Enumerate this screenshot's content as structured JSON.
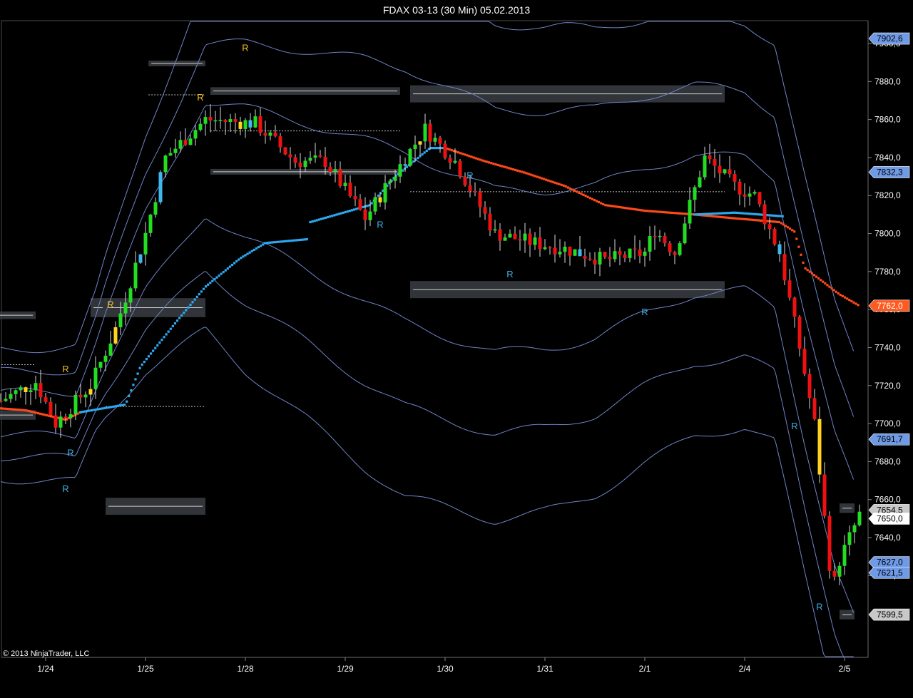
{
  "title": "FDAX 03-13 (30 Min)  05.02.2013",
  "copyright": "© 2013 NinjaTrader, LLC",
  "colors": {
    "background": "#000000",
    "up": "#22dd22",
    "down": "#ee1111",
    "highlight": "#ffd21e",
    "reversal_bar": "#3fb8f0",
    "band": "#6f84c8",
    "trail_up": "#2ea8f0",
    "trail_down": "#ff4a1a",
    "zone": "#3a3d42"
  },
  "chart_data": {
    "type": "candlestick",
    "ylim": [
      7577,
      7912
    ],
    "y_ticks": [
      "7900,0",
      "7880,0",
      "7860,0",
      "7840,0",
      "7820,0",
      "7800,0",
      "7780,0",
      "7760,0",
      "7740,0",
      "7720,0",
      "7700,0",
      "7680,0",
      "7660,0",
      "7640,0",
      "7620,0"
    ],
    "x_ticks": [
      "1/24",
      "1/25",
      "1/28",
      "1/29",
      "1/30",
      "1/31",
      "2/1",
      "2/4",
      "2/5"
    ],
    "price_badges": [
      {
        "label": "7902,6",
        "value": 7902.6,
        "style": "blue"
      },
      {
        "label": "7832,3",
        "value": 7832.3,
        "style": "blue"
      },
      {
        "label": "7762,0",
        "value": 7762.0,
        "style": "orange"
      },
      {
        "label": "7691,7",
        "value": 7691.7,
        "style": "blue"
      },
      {
        "label": "7654,5",
        "value": 7654.5,
        "style": "grey"
      },
      {
        "label": "7650,0",
        "value": 7650.0,
        "style": "white"
      },
      {
        "label": "7627,0",
        "value": 7627.0,
        "style": "blue"
      },
      {
        "label": "7621,5",
        "value": 7621.5,
        "style": "blue"
      },
      {
        "label": "7599,5",
        "value": 7599.5,
        "style": "grey"
      }
    ],
    "signals": [
      {
        "label": "R",
        "session": 0.2,
        "value": 7664,
        "color": "blue"
      },
      {
        "label": "R",
        "session": 0.25,
        "value": 7683,
        "color": "blue"
      },
      {
        "label": "R",
        "session": 0.2,
        "value": 7727,
        "color": "yellow"
      },
      {
        "label": "R",
        "session": 0.65,
        "value": 7761,
        "color": "yellow"
      },
      {
        "label": "R",
        "session": 1.55,
        "value": 7870,
        "color": "yellow"
      },
      {
        "label": "R",
        "session": 2.0,
        "value": 7896,
        "color": "yellow"
      },
      {
        "label": "R",
        "session": 3.35,
        "value": 7803,
        "color": "blue"
      },
      {
        "label": "R",
        "session": 4.25,
        "value": 7829,
        "color": "blue"
      },
      {
        "label": "R",
        "session": 4.65,
        "value": 7777,
        "color": "blue"
      },
      {
        "label": "R",
        "session": 6.0,
        "value": 7757,
        "color": "blue"
      },
      {
        "label": "R",
        "session": 7.5,
        "value": 7697,
        "color": "blue"
      },
      {
        "label": "R",
        "session": 7.75,
        "value": 7602,
        "color": "blue"
      }
    ],
    "zones": [
      {
        "x0": -0.5,
        "x1": -0.1,
        "y0": 7755,
        "y1": 7759
      },
      {
        "x0": -0.5,
        "x1": -0.1,
        "y0": 7702,
        "y1": 7707
      },
      {
        "x0": 0.45,
        "x1": 0.6,
        "y0": 7756,
        "y1": 7766
      },
      {
        "x0": 0.6,
        "x1": 1.6,
        "y0": 7756,
        "y1": 7766
      },
      {
        "x0": 0.6,
        "x1": 1.6,
        "y0": 7652,
        "y1": 7661
      },
      {
        "x0": 1.03,
        "x1": 1.6,
        "y0": 7888,
        "y1": 7891
      },
      {
        "x0": 1.65,
        "x1": 3.55,
        "y0": 7873,
        "y1": 7877
      },
      {
        "x0": 1.65,
        "x1": 3.55,
        "y0": 7831,
        "y1": 7834
      },
      {
        "x0": 3.65,
        "x1": 6.8,
        "y0": 7869,
        "y1": 7878
      },
      {
        "x0": 3.65,
        "x1": 6.8,
        "y0": 7766,
        "y1": 7775
      },
      {
        "x0": 7.95,
        "x1": 8.1,
        "y0": 7653,
        "y1": 7658
      },
      {
        "x0": 7.95,
        "x1": 8.1,
        "y0": 7597,
        "y1": 7602
      }
    ],
    "ref_lines": [
      {
        "x0": -0.5,
        "x1": -0.1,
        "value": 7731
      },
      {
        "x0": 0.6,
        "x1": 1.6,
        "value": 7709
      },
      {
        "x0": 1.03,
        "x1": 1.6,
        "value": 7873
      },
      {
        "x0": 1.65,
        "x1": 3.55,
        "value": 7854
      },
      {
        "x0": 3.65,
        "x1": 6.8,
        "value": 7822
      }
    ],
    "anchors": [
      [
        -0.45,
        7712
      ],
      [
        -0.1,
        7722
      ],
      [
        0.1,
        7700
      ],
      [
        0.45,
        7720
      ],
      [
        0.7,
        7750
      ],
      [
        1.0,
        7800
      ],
      [
        1.2,
        7840
      ],
      [
        1.6,
        7860
      ],
      [
        2.1,
        7858
      ],
      [
        2.5,
        7838
      ],
      [
        2.8,
        7838
      ],
      [
        3.2,
        7808
      ],
      [
        3.5,
        7832
      ],
      [
        3.8,
        7855
      ],
      [
        4.1,
        7838
      ],
      [
        4.5,
        7800
      ],
      [
        4.9,
        7795
      ],
      [
        5.2,
        7792
      ],
      [
        5.6,
        7786
      ],
      [
        6.0,
        7790
      ],
      [
        6.1,
        7802
      ],
      [
        6.3,
        7790
      ],
      [
        6.6,
        7840
      ],
      [
        6.9,
        7825
      ],
      [
        7.1,
        7820
      ],
      [
        7.35,
        7790
      ],
      [
        7.55,
        7740
      ],
      [
        7.7,
        7700
      ],
      [
        7.8,
        7650
      ],
      [
        7.88,
        7612
      ],
      [
        7.95,
        7628
      ],
      [
        8.05,
        7640
      ],
      [
        8.15,
        7652
      ]
    ],
    "bands_center": [
      [
        -0.45,
        7705
      ],
      [
        0.3,
        7705
      ],
      [
        0.6,
        7745
      ],
      [
        1.0,
        7790
      ],
      [
        1.6,
        7840
      ],
      [
        2.6,
        7820
      ],
      [
        3.5,
        7800
      ],
      [
        4.0,
        7790
      ],
      [
        4.5,
        7780
      ],
      [
        5.0,
        7781
      ],
      [
        5.5,
        7785
      ],
      [
        6.0,
        7796
      ],
      [
        6.5,
        7805
      ],
      [
        7.0,
        7805
      ],
      [
        7.3,
        7795
      ],
      [
        7.6,
        7725
      ],
      [
        7.9,
        7660
      ],
      [
        8.1,
        7632
      ]
    ],
    "bands_width": [
      [
        -0.45,
        26
      ],
      [
        0.5,
        28
      ],
      [
        1.0,
        48
      ],
      [
        1.6,
        70
      ],
      [
        2.0,
        80
      ],
      [
        2.6,
        90
      ],
      [
        3.2,
        100
      ],
      [
        3.6,
        105
      ],
      [
        4.0,
        103
      ],
      [
        4.6,
        100
      ],
      [
        5.2,
        97
      ],
      [
        6.0,
        90
      ],
      [
        6.6,
        85
      ],
      [
        7.0,
        82
      ],
      [
        7.4,
        80
      ],
      [
        7.8,
        80
      ],
      [
        8.1,
        82
      ]
    ],
    "trail_up_pts": [
      [
        0.35,
        7706
      ],
      [
        0.8,
        7710
      ],
      [
        0.95,
        7730
      ],
      [
        1.3,
        7753
      ],
      [
        1.6,
        7772
      ],
      [
        1.95,
        7787
      ],
      [
        2.2,
        7795
      ],
      [
        2.62,
        7797
      ]
    ],
    "trail_up2_pts": [
      [
        2.65,
        7806
      ],
      [
        3.25,
        7815
      ],
      [
        3.5,
        7830
      ],
      [
        3.85,
        7845
      ],
      [
        4.0,
        7845
      ]
    ],
    "trail_up3_pts": [
      [
        6.5,
        7810
      ],
      [
        6.9,
        7811
      ],
      [
        7.4,
        7809
      ]
    ],
    "trail_down_pts": [
      [
        -0.45,
        7708
      ],
      [
        -0.2,
        7707
      ],
      [
        0.2,
        7702
      ],
      [
        0.35,
        7706
      ]
    ],
    "trail_down2_pts": [
      [
        4.0,
        7845
      ],
      [
        4.4,
        7838
      ],
      [
        4.8,
        7832
      ],
      [
        5.2,
        7825
      ],
      [
        5.6,
        7815
      ],
      [
        6.0,
        7812
      ],
      [
        6.5,
        7810
      ],
      [
        6.9,
        7808
      ],
      [
        7.35,
        7806
      ],
      [
        7.5,
        7801
      ],
      [
        7.6,
        7782
      ],
      [
        7.8,
        7774
      ],
      [
        7.95,
        7768
      ],
      [
        8.15,
        7762
      ]
    ]
  }
}
